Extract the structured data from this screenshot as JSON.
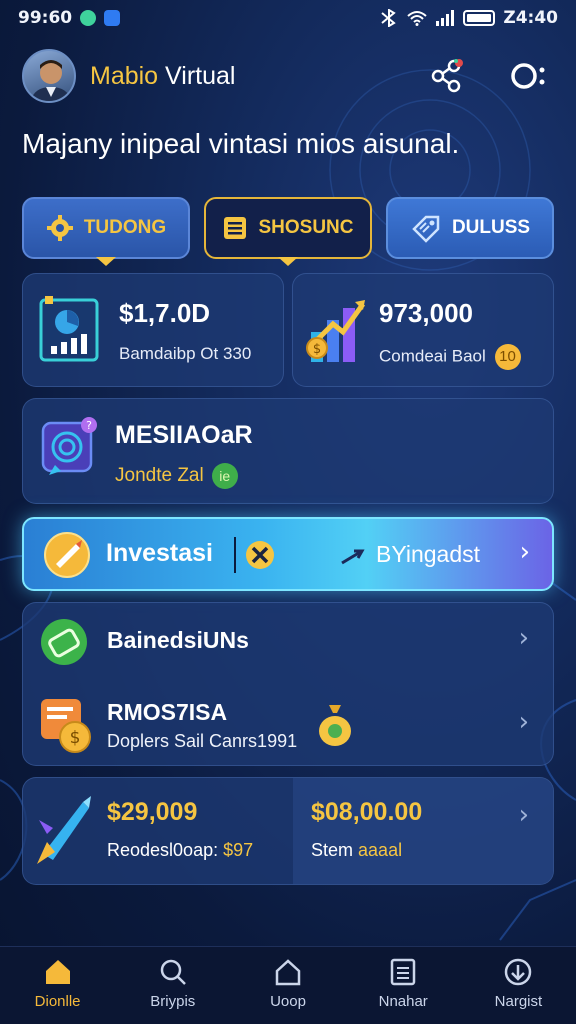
{
  "status_bar": {
    "time": "99:60",
    "right_time": "Z4:40"
  },
  "header": {
    "app_name_part1": "Mabio",
    "app_name_part2": "Virtual"
  },
  "headline": "Majany inipeal vintasi mios aisunal.",
  "tabs": [
    {
      "label": "TUDONG",
      "icon": "settings-gear-icon"
    },
    {
      "label": "SHOSUNC",
      "icon": "document-list-icon"
    },
    {
      "label": "DULUSS",
      "icon": "tag-icon"
    }
  ],
  "stats": [
    {
      "value": "$1,7.0D",
      "subtitle": "Bamdaibp Ot 330",
      "icon": "analytics-board-icon"
    },
    {
      "value": "973,000",
      "subtitle": "Comdeai Baol",
      "badge": "10",
      "icon": "growth-chart-icon"
    }
  ],
  "message": {
    "title": "MESIIAOaR",
    "subtitle": "Jondte Zal",
    "badge": "ie",
    "icon": "chat-target-icon"
  },
  "invest": {
    "label": "Investasi",
    "right_label": "BYingadst"
  },
  "list": [
    {
      "title": "BainedsiUNs",
      "icon": "wallet-icon"
    },
    {
      "title": "RMOS7ISA",
      "subtitle": "Doplers Sail Canrs1991",
      "icon": "invoice-coin-icon"
    }
  ],
  "bottom": {
    "left_value": "$29,009",
    "left_sub": "Reodesl0oap:",
    "left_sub_highlight": "$97",
    "right_value": "$08,00.00",
    "right_sub": "Stem",
    "right_sub_highlight": "aaaal"
  },
  "nav": [
    {
      "label": "Dionlle",
      "icon": "home-icon",
      "active": true
    },
    {
      "label": "Briypis",
      "icon": "search-icon"
    },
    {
      "label": "Uoop",
      "icon": "house-outline-icon"
    },
    {
      "label": "Nnahar",
      "icon": "list-icon"
    },
    {
      "label": "Nargist",
      "icon": "download-circle-icon"
    }
  ],
  "colors": {
    "accent_gold": "#f5c542",
    "bg_dark": "#0b1a3d",
    "card": "#1e3a73",
    "invest_cyan": "#52d0f5"
  }
}
